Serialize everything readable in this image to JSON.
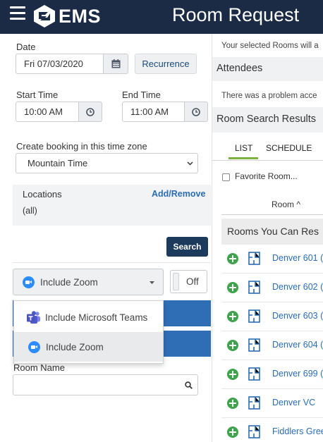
{
  "header": {
    "logo_text": "EMS",
    "title": "Room Request",
    "colors": {
      "bar": "#1b2b45"
    }
  },
  "form": {
    "date_label": "Date",
    "date_value": "Fri 07/03/2020",
    "recurrence_label": "Recurrence",
    "start_time_label": "Start Time",
    "start_time_value": "10:00 AM",
    "end_time_label": "End Time",
    "end_time_value": "11:00 AM",
    "timezone_label": "Create booking in this time zone",
    "timezone_value": "Mountain Time",
    "locations_label": "Locations",
    "add_remove_label": "Add/Remove",
    "locations_value": "(all)",
    "search_label": "Search",
    "video_select_value": "Include Zoom",
    "toggle_label": "Off",
    "room_name_label": "Room Name",
    "room_name_value": ""
  },
  "video_dropdown": {
    "options": [
      {
        "label": "Include Microsoft Teams",
        "icon": "teams-icon"
      },
      {
        "label": "Include Zoom",
        "icon": "zoom-icon",
        "selected": true
      }
    ]
  },
  "right_panel": {
    "selected_rooms_text": "Your selected Rooms will a",
    "attendees_label": "Attendees",
    "problem_text": "There was a problem acce",
    "results_title": "Room Search Results",
    "tabs": [
      "LIST",
      "SCHEDULE"
    ],
    "favorite_rooms_label": "Favorite Room...",
    "room_column_header": "Room ^",
    "group_header": "Rooms You Can Res",
    "rooms": [
      "Denver 601 (r",
      "Denver 602 (F",
      "Denver 603 (N",
      "Denver 604 (F",
      "Denver 699 (F",
      "Denver VC",
      "Fiddlers Gree"
    ]
  }
}
